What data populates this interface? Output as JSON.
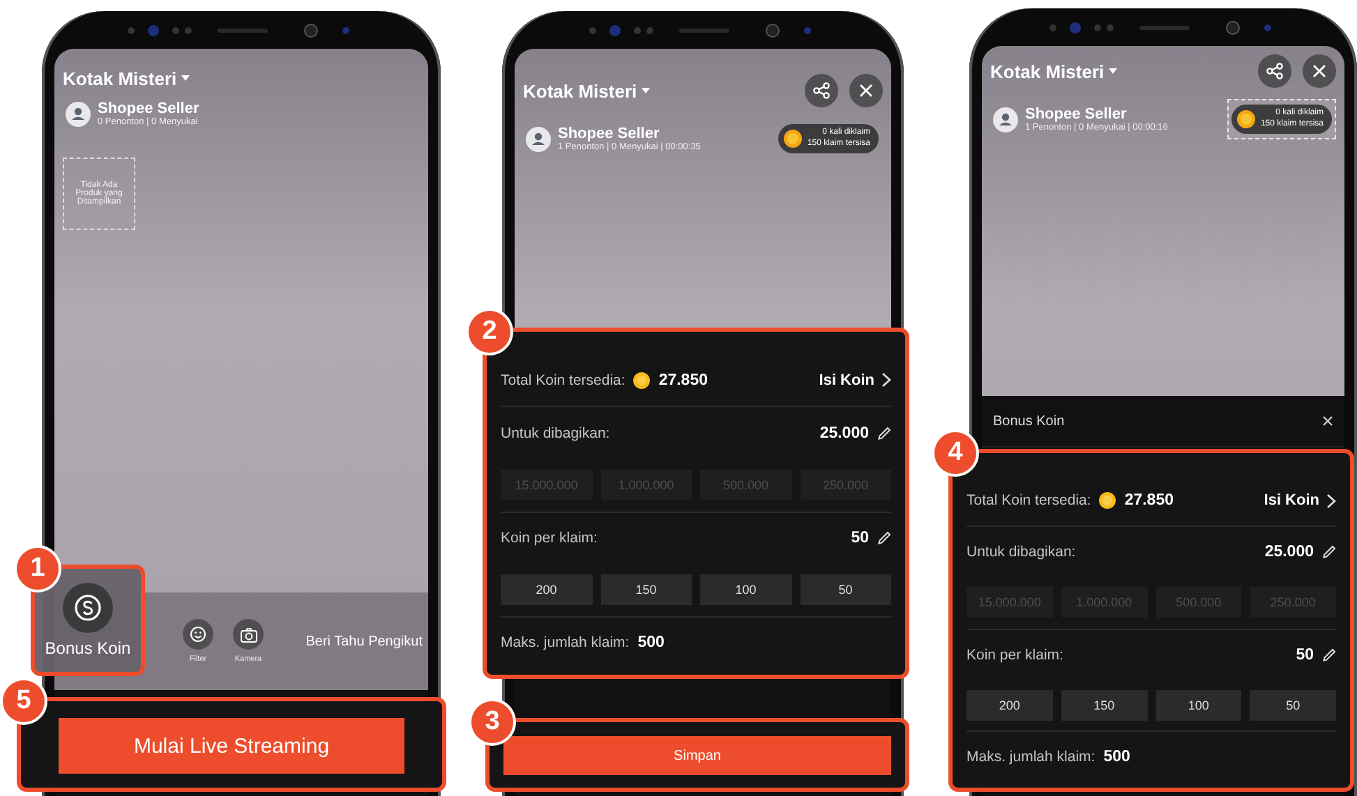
{
  "phones": [
    {
      "kind": "start",
      "title": "Kotak Misteri",
      "seller": {
        "name": "Shopee Seller",
        "stats": "0 Penonton | 0 Menyukai"
      },
      "product_placeholder": "Tidak Ada Produk yang Ditampilkan",
      "bonus_button": "Bonus Koin",
      "tools": [
        {
          "label": "Filter",
          "kind": "filter"
        },
        {
          "label": "Kamera",
          "kind": "camera"
        }
      ],
      "notify": "Beri Tahu Pengikut",
      "start_button": "Mulai Live Streaming",
      "callouts": [
        {
          "number": "1",
          "kind": "bonus"
        },
        {
          "number": "5",
          "kind": "start"
        }
      ]
    },
    {
      "kind": "settings",
      "title": "Kotak Misteri",
      "seller": {
        "name": "Shopee Seller",
        "stats": "1 Penonton | 0 Menyukai | 00:00:35"
      },
      "claim_badge": {
        "claimed": "0 kali diklaim",
        "remaining": "150 klaim tersisa",
        "highlighted": false
      },
      "panel": {
        "total_label": "Total Koin tersedia:",
        "total_value": "27.850",
        "topup": "Isi Koin",
        "share_label": "Untuk dibagikan:",
        "share_value": "25.000",
        "share_options": [
          {
            "label": "15.000.000",
            "disabled": true
          },
          {
            "label": "1.000.000",
            "disabled": true
          },
          {
            "label": "500.000",
            "disabled": true
          },
          {
            "label": "250.000",
            "disabled": true
          }
        ],
        "claim_label": "Koin per klaim:",
        "claim_value": "50",
        "claim_options": [
          {
            "label": "200",
            "disabled": false
          },
          {
            "label": "150",
            "disabled": false
          },
          {
            "label": "100",
            "disabled": false
          },
          {
            "label": "50",
            "disabled": false
          }
        ],
        "max_label": "Maks. jumlah klaim:",
        "max_value": "500"
      },
      "save_button": "Simpan",
      "callouts": [
        {
          "number": "2",
          "kind": "panel"
        },
        {
          "number": "3",
          "kind": "save"
        }
      ]
    },
    {
      "kind": "settings",
      "title": "Kotak Misteri",
      "seller": {
        "name": "Shopee Seller",
        "stats": "1 Penonton | 0 Menyukai | 00:00:16"
      },
      "claim_badge": {
        "claimed": "0 kali diklaim",
        "remaining": "150 klaim tersisa",
        "highlighted": true
      },
      "sheet_title": "Bonus Koin",
      "panel": {
        "total_label": "Total Koin tersedia:",
        "total_value": "27.850",
        "topup": "Isi Koin",
        "share_label": "Untuk dibagikan:",
        "share_value": "25.000",
        "share_options": [
          {
            "label": "15.000.000",
            "disabled": true
          },
          {
            "label": "1.000.000",
            "disabled": true
          },
          {
            "label": "500.000",
            "disabled": true
          },
          {
            "label": "250.000",
            "disabled": true
          }
        ],
        "claim_label": "Koin per klaim:",
        "claim_value": "50",
        "claim_options": [
          {
            "label": "200",
            "disabled": false
          },
          {
            "label": "150",
            "disabled": false
          },
          {
            "label": "100",
            "disabled": false
          },
          {
            "label": "50",
            "disabled": false
          }
        ],
        "max_label": "Maks. jumlah klaim:",
        "max_value": "500"
      },
      "callouts": [
        {
          "number": "4",
          "kind": "panel"
        }
      ]
    }
  ]
}
